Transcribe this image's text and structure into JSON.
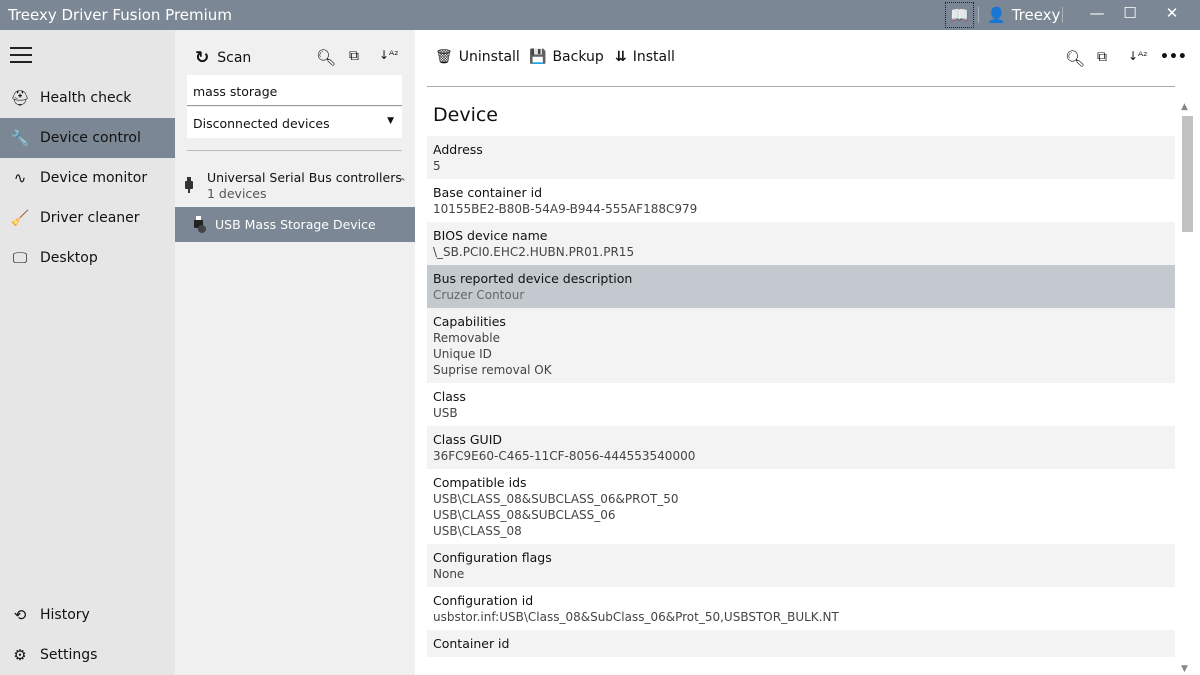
{
  "window": {
    "title": "Treexy Driver Fusion Premium",
    "user": "Treexy"
  },
  "sidebar": {
    "items": [
      {
        "label": "Health check",
        "icon": "medkit-icon",
        "glyph": "⛑"
      },
      {
        "label": "Device control",
        "icon": "wrench-icon",
        "glyph": "🔧"
      },
      {
        "label": "Device monitor",
        "icon": "pulse-icon",
        "glyph": "∿"
      },
      {
        "label": "Driver cleaner",
        "icon": "broom-icon",
        "glyph": "🧹"
      },
      {
        "label": "Desktop",
        "icon": "monitor-icon",
        "glyph": "🖵"
      }
    ],
    "bottom": [
      {
        "label": "History",
        "icon": "history-icon",
        "glyph": "⟲"
      },
      {
        "label": "Settings",
        "icon": "gear-icon",
        "glyph": "⚙"
      }
    ],
    "selected": 1
  },
  "middle": {
    "scan_label": "Scan",
    "search_value": "mass storage",
    "filter_value": "Disconnected devices",
    "group": {
      "label": "Universal Serial Bus controllers",
      "count": "1 devices"
    },
    "device": "USB Mass Storage Device"
  },
  "main": {
    "toolbar": {
      "uninstall": "Uninstall",
      "backup": "Backup",
      "install": "Install"
    },
    "section_title": "Device",
    "rows": [
      {
        "key": "Address",
        "values": [
          "5"
        ]
      },
      {
        "key": "Base container id",
        "values": [
          "10155BE2-B80B-54A9-B944-555AF188C979"
        ]
      },
      {
        "key": "BIOS device name",
        "values": [
          "\\_SB.PCI0.EHC2.HUBN.PR01.PR15"
        ]
      },
      {
        "key": "Bus reported device description",
        "values": [
          "Cruzer Contour"
        ],
        "selected": true
      },
      {
        "key": "Capabilities",
        "values": [
          "Removable",
          "Unique ID",
          "Suprise removal OK"
        ]
      },
      {
        "key": "Class",
        "values": [
          "USB"
        ]
      },
      {
        "key": "Class GUID",
        "values": [
          "36FC9E60-C465-11CF-8056-444553540000"
        ]
      },
      {
        "key": "Compatible ids",
        "values": [
          "USB\\CLASS_08&SUBCLASS_06&PROT_50",
          "USB\\CLASS_08&SUBCLASS_06",
          "USB\\CLASS_08"
        ]
      },
      {
        "key": "Configuration flags",
        "values": [
          "None"
        ]
      },
      {
        "key": "Configuration id",
        "values": [
          "usbstor.inf:USB\\Class_08&SubClass_06&Prot_50,USBSTOR_BULK.NT"
        ]
      },
      {
        "key": "Container id",
        "values": []
      }
    ]
  },
  "colors": {
    "accent": "#7b8794",
    "selected_row": "#c4c9cf",
    "alt_row": "#f3f3f3"
  }
}
